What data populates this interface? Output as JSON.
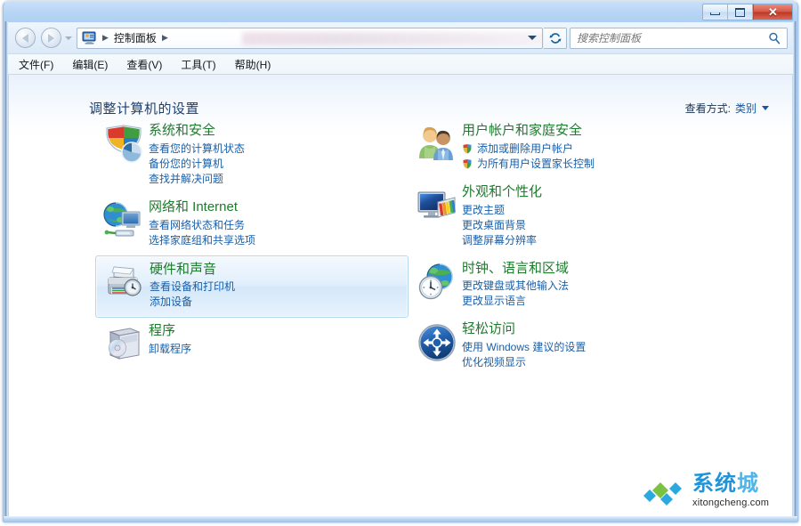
{
  "window": {
    "titlebar": {
      "minimize_label": "最小化",
      "maximize_label": "最大化",
      "close_label": "✕"
    }
  },
  "navbar": {
    "back_label": "后退",
    "forward_label": "前进",
    "recent_pages_label": "最近浏览的页面",
    "breadcrumb": {
      "icon": "control-panel-icon",
      "items": [
        "控制面板"
      ],
      "leading_separator": "▶",
      "trailing_separator": "▶"
    },
    "refresh_label": "↻",
    "search": {
      "placeholder": "搜索控制面板",
      "value": "",
      "icon": "search-icon"
    }
  },
  "menubar": {
    "items": [
      {
        "label": "文件(F)"
      },
      {
        "label": "编辑(E)"
      },
      {
        "label": "查看(V)"
      },
      {
        "label": "工具(T)"
      },
      {
        "label": "帮助(H)"
      }
    ]
  },
  "page": {
    "title": "调整计算机的设置",
    "viewby": {
      "label": "查看方式:",
      "value": "类别"
    }
  },
  "categories": {
    "left": [
      {
        "icon": "shield-security-icon",
        "title": "系统和安全",
        "hovered": false,
        "links": [
          {
            "text": "查看您的计算机状态",
            "shield": false
          },
          {
            "text": "备份您的计算机",
            "shield": false
          },
          {
            "text": "查找并解决问题",
            "shield": false
          }
        ]
      },
      {
        "icon": "network-internet-icon",
        "title": "网络和 Internet",
        "hovered": false,
        "links": [
          {
            "text": "查看网络状态和任务",
            "shield": false
          },
          {
            "text": "选择家庭组和共享选项",
            "shield": false
          }
        ]
      },
      {
        "icon": "hardware-sound-icon",
        "title": "硬件和声音",
        "hovered": true,
        "links": [
          {
            "text": "查看设备和打印机",
            "shield": false
          },
          {
            "text": "添加设备",
            "shield": false
          }
        ]
      },
      {
        "icon": "programs-icon",
        "title": "程序",
        "hovered": false,
        "links": [
          {
            "text": "卸载程序",
            "shield": false
          }
        ]
      }
    ],
    "right": [
      {
        "icon": "user-accounts-icon",
        "title": "用户帐户和家庭安全",
        "hovered": false,
        "links": [
          {
            "text": "添加或删除用户帐户",
            "shield": true
          },
          {
            "text": "为所有用户设置家长控制",
            "shield": true
          }
        ]
      },
      {
        "icon": "appearance-personalization-icon",
        "title": "外观和个性化",
        "hovered": false,
        "links": [
          {
            "text": "更改主题",
            "shield": false
          },
          {
            "text": "更改桌面背景",
            "shield": false
          },
          {
            "text": "调整屏幕分辨率",
            "shield": false
          }
        ]
      },
      {
        "icon": "clock-language-region-icon",
        "title": "时钟、语言和区域",
        "hovered": false,
        "links": [
          {
            "text": "更改键盘或其他输入法",
            "shield": false
          },
          {
            "text": "更改显示语言",
            "shield": false
          }
        ]
      },
      {
        "icon": "ease-of-access-icon",
        "title": "轻松访问",
        "hovered": false,
        "links": [
          {
            "text": "使用 Windows 建议的设置",
            "shield": false
          },
          {
            "text": "优化视频显示",
            "shield": false
          }
        ]
      }
    ]
  },
  "watermark": {
    "title_main": "系统",
    "title_accent": "城",
    "subtitle": "xitongcheng.com"
  },
  "colors": {
    "category_title": "#1f7a2e",
    "link": "#1a5fa8",
    "page_title": "#1b3f72",
    "accent_blue": "#2193d8",
    "accent_green": "#7cc242",
    "close_red": "#bf3827"
  }
}
